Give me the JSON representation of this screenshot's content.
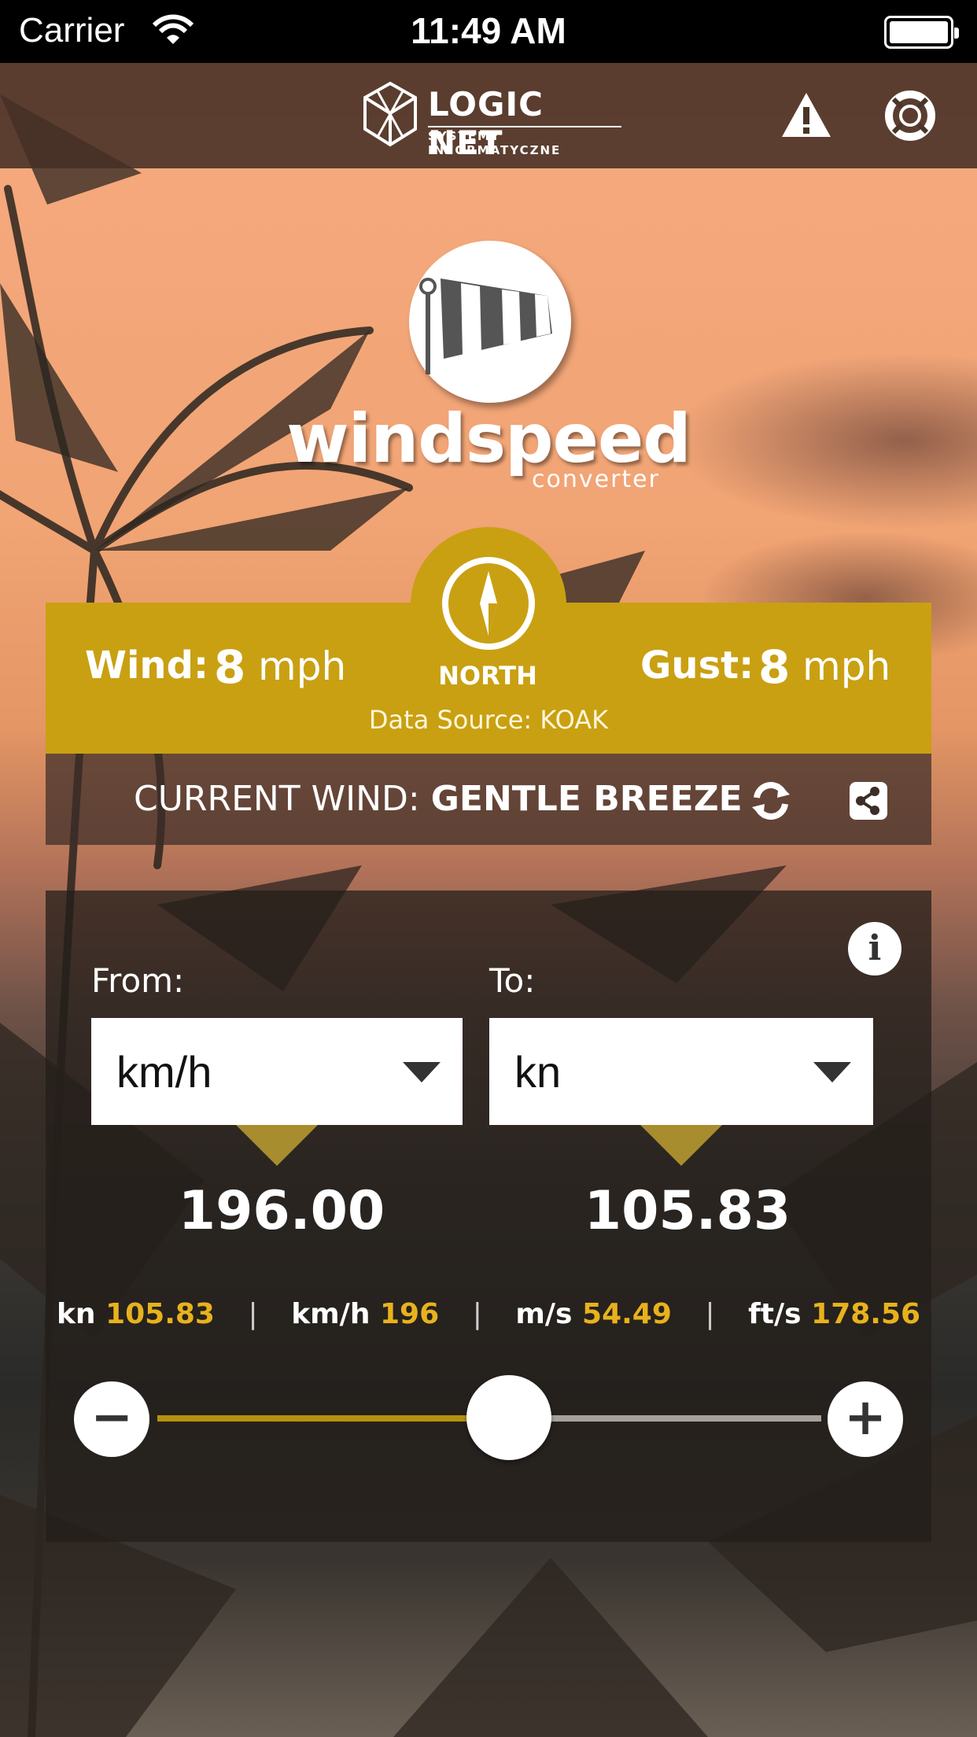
{
  "status_bar": {
    "carrier": "Carrier",
    "time": "11:49 AM"
  },
  "header": {
    "brand_name": "LOGIC NET",
    "brand_tagline": "SYSTEMY INFORMATYCZNE",
    "icons": [
      "warning-icon",
      "lifebuoy-icon"
    ]
  },
  "app_logo": {
    "title": "windspeed",
    "subtitle": "converter"
  },
  "wind": {
    "wind_label": "Wind:",
    "wind_value": "8",
    "wind_unit": "mph",
    "direction": "NORTH",
    "gust_label": "Gust:",
    "gust_value": "8",
    "gust_unit": "mph",
    "data_source": "Data Source: KOAK"
  },
  "current": {
    "prefix": "CURRENT WIND:",
    "value": "GENTLE BREEZE"
  },
  "converter": {
    "from_label": "From:",
    "to_label": "To:",
    "from_unit": "km/h",
    "to_unit": "kn",
    "from_value": "196.00",
    "to_value": "105.83",
    "summary": [
      {
        "unit": "kn",
        "value": "105.83"
      },
      {
        "unit": "km/h",
        "value": "196"
      },
      {
        "unit": "m/s",
        "value": "54.49"
      },
      {
        "unit": "ft/s",
        "value": "178.56"
      }
    ],
    "slider_fraction": 0.53,
    "minus_label": "−",
    "plus_label": "+"
  },
  "colors": {
    "accent": "#c9a012",
    "value_yellow": "#e8b21d"
  }
}
